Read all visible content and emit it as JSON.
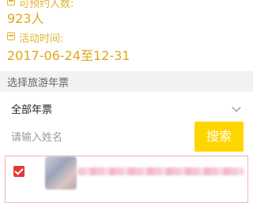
{
  "info": {
    "count_label": "可预约人数:",
    "count_value": "923人",
    "time_label": "活动时间:",
    "time_value": "2017-06-24至12-31"
  },
  "section": {
    "title": "选择旅游年票"
  },
  "ticket_select": {
    "value": "全部年票"
  },
  "search": {
    "placeholder": "请输入姓名",
    "button_label": "搜索"
  },
  "colors": {
    "accent_yellow": "#ffd500",
    "label_gold": "#e1b331",
    "check_red": "#e53935"
  }
}
